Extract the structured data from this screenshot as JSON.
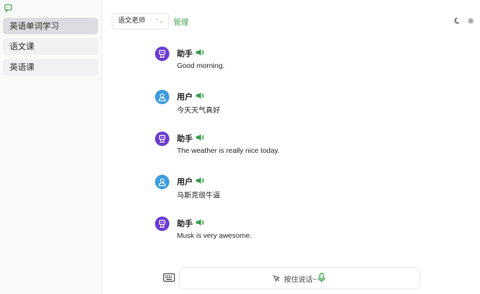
{
  "sidebar": {
    "items": [
      {
        "label": "英语单词学习",
        "active": true
      },
      {
        "label": "语文课",
        "active": false
      },
      {
        "label": "英语课",
        "active": false
      }
    ]
  },
  "header": {
    "select_value": "语文老师",
    "manage_label": "管理"
  },
  "messages": [
    {
      "role": "助手",
      "type": "assistant",
      "text": "Good morning."
    },
    {
      "role": "用户",
      "type": "user",
      "text": "今天天气真好"
    },
    {
      "role": "助手",
      "type": "assistant",
      "text": "The weather is really nice today."
    },
    {
      "role": "用户",
      "type": "user",
      "text": "马斯克很牛逼"
    },
    {
      "role": "助手",
      "type": "assistant",
      "text": "Musk is very awesome."
    }
  ],
  "input": {
    "voice_label": "按住说话~"
  },
  "colors": {
    "accent": "#3fa24f",
    "assistant_avatar": "#6b3ad1",
    "user_avatar": "#3a9bdc"
  },
  "icons": [
    "chat-logo-icon",
    "moon-icon",
    "gear-icon",
    "robot-icon",
    "user-icon",
    "speaker-icon",
    "keyboard-icon",
    "cursor-icon",
    "microphone-icon"
  ]
}
